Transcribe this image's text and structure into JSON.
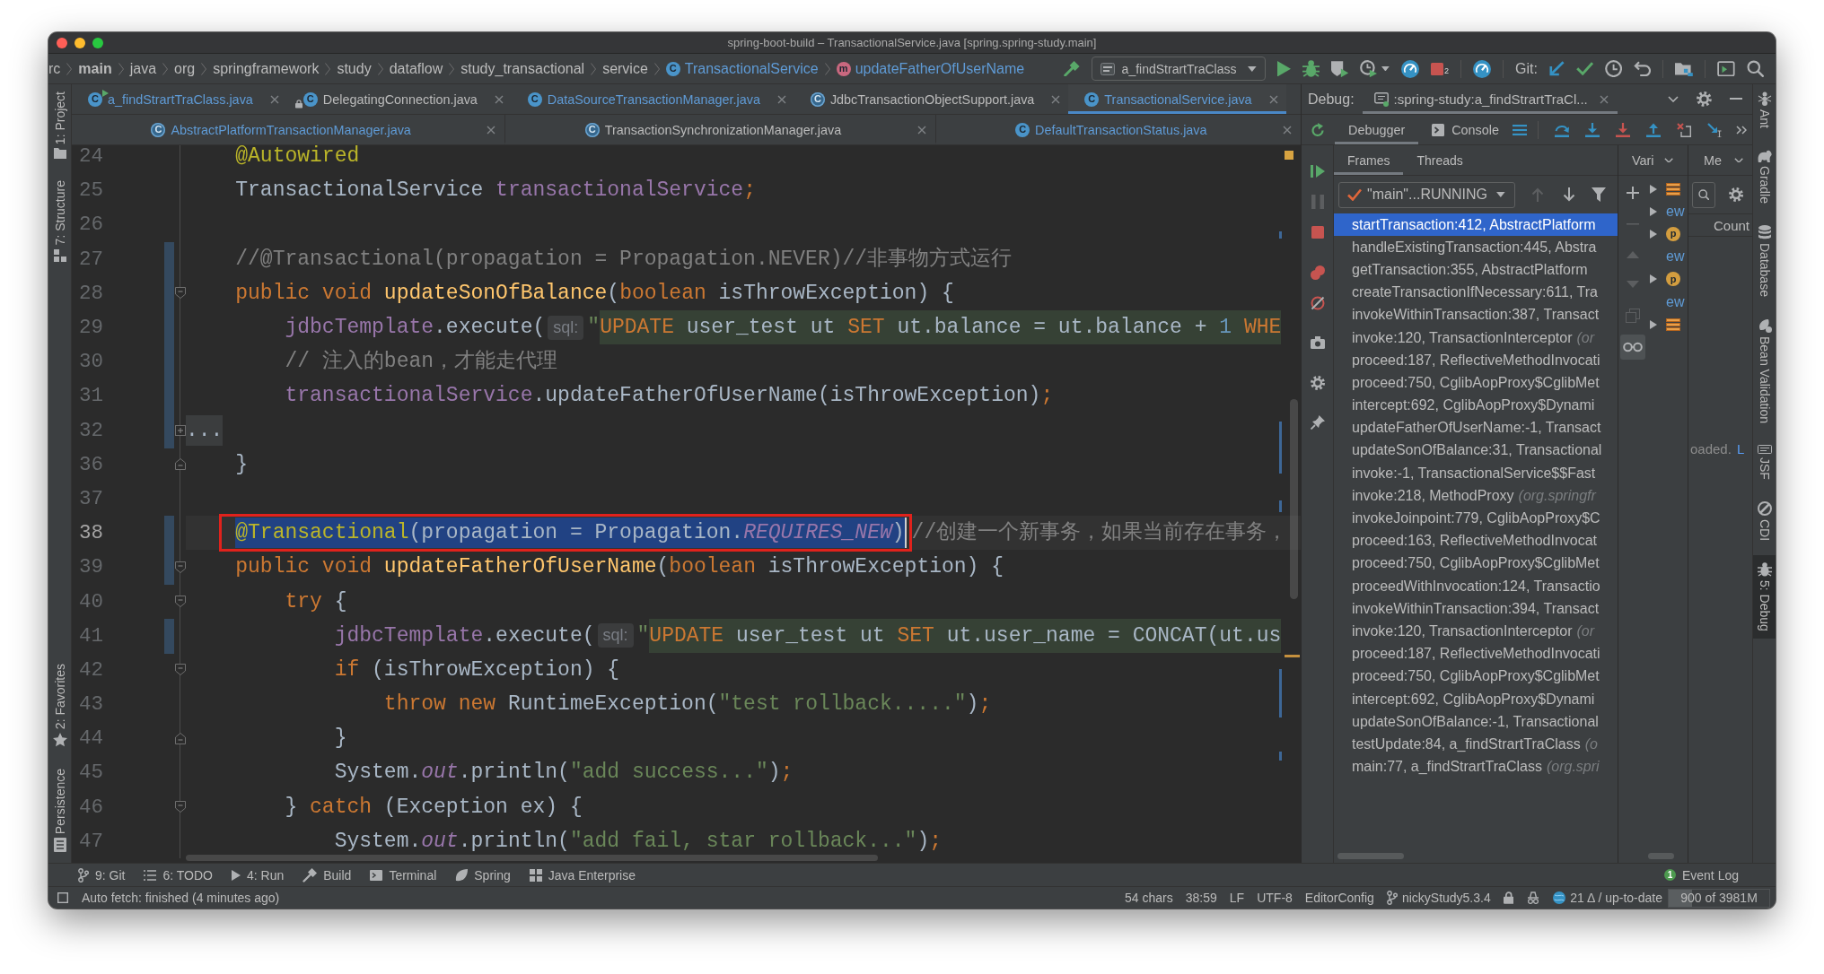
{
  "window": {
    "title": "spring-boot-build – TransactionalService.java [spring.spring-study.main]"
  },
  "navigation": {
    "breadcrumb": [
      {
        "label": "rc",
        "kind": "folder"
      },
      {
        "label": "main",
        "kind": "source_root"
      },
      {
        "label": "java",
        "kind": "folder"
      },
      {
        "label": "org",
        "kind": "folder"
      },
      {
        "label": "springframework",
        "kind": "folder"
      },
      {
        "label": "study",
        "kind": "folder"
      },
      {
        "label": "dataflow",
        "kind": "folder"
      },
      {
        "label": "study_transactional",
        "kind": "folder"
      },
      {
        "label": "service",
        "kind": "folder"
      },
      {
        "label": "TransactionalService",
        "kind": "class",
        "icon_letter": "C"
      },
      {
        "label": "updateFatherOfUserName",
        "kind": "method",
        "icon_letter": "m"
      }
    ],
    "run_configuration": "a_findStrartTraClass",
    "stop_count": "2",
    "vcs_label": "Git:"
  },
  "left_stripe": {
    "top": [
      {
        "label": "1: Project",
        "kind": "project"
      },
      {
        "label": "7: Structure",
        "kind": "structure"
      }
    ],
    "bottom": [
      {
        "label": "2: Favorites",
        "kind": "favorites"
      },
      {
        "label": "Persistence",
        "kind": "persistence"
      }
    ]
  },
  "editor_tabs": [
    [
      {
        "label": "a_findStrartTraClass.java",
        "kind": "main_class",
        "icon_letter": "C",
        "modified": true,
        "read_only": false,
        "selected": false
      },
      {
        "label": "DelegatingConnection.java",
        "kind": "class",
        "icon_letter": "C",
        "modified": false,
        "read_only": true,
        "selected": false
      },
      {
        "label": "DataSourceTransactionManager.java",
        "kind": "class",
        "icon_letter": "C",
        "modified": true,
        "read_only": false,
        "selected": false
      },
      {
        "label": "JdbcTransactionObjectSupport.java",
        "kind": "abstract_class",
        "icon_letter": "C",
        "modified": false,
        "read_only": false,
        "selected": false
      },
      {
        "label": "TransactionalService.java",
        "kind": "class",
        "icon_letter": "C",
        "modified": true,
        "read_only": false,
        "selected": true
      }
    ],
    [
      {
        "label": "AbstractPlatformTransactionManager.java",
        "kind": "abstract_class",
        "icon_letter": "C",
        "modified": true,
        "read_only": false,
        "selected": false
      },
      {
        "label": "TransactionSynchronizationManager.java",
        "kind": "abstract_class",
        "icon_letter": "C",
        "modified": false,
        "read_only": false,
        "selected": false
      },
      {
        "label": "DefaultTransactionStatus.java",
        "kind": "class",
        "icon_letter": "C",
        "modified": true,
        "read_only": false,
        "selected": false
      }
    ]
  ],
  "editor": {
    "lines": [
      {
        "number": "24",
        "kind": "plain",
        "current": false,
        "changed": false,
        "tokens": [
          {
            "kind": "annotation",
            "text": "    @Autowired"
          }
        ]
      },
      {
        "number": "25",
        "kind": "plain",
        "current": false,
        "changed": false,
        "tokens": [
          {
            "kind": "plain",
            "text": "    TransactionalService "
          },
          {
            "kind": "field",
            "text": "transactionalService"
          },
          {
            "kind": "keyword",
            "text": ";"
          }
        ]
      },
      {
        "number": "26",
        "kind": "plain",
        "current": false,
        "changed": false
      },
      {
        "number": "27",
        "kind": "plain",
        "current": false,
        "changed": true,
        "tokens": [
          {
            "kind": "comment",
            "text": "    //@Transactional(propagation = Propagation.NEVER)//非事物方式运行"
          }
        ]
      },
      {
        "number": "28",
        "kind": "fold_start",
        "current": false,
        "changed": true,
        "tokens": [
          {
            "kind": "keyword",
            "text": "    public void "
          },
          {
            "kind": "method",
            "text": "updateSonOfBalance"
          },
          {
            "kind": "plain",
            "text": "("
          },
          {
            "kind": "keyword",
            "text": "boolean "
          },
          {
            "kind": "plain",
            "text": "isThrowException) {"
          }
        ]
      },
      {
        "number": "29",
        "kind": "plain",
        "current": false,
        "changed": true,
        "tokens": [
          {
            "kind": "field",
            "text": "        jdbcTemplate"
          },
          {
            "kind": "plain",
            "text": ".execute("
          },
          {
            "kind": "hint",
            "text": "sql:"
          },
          {
            "kind": "string",
            "text": "\""
          },
          {
            "kind": "sql_keyword",
            "text": "UPDATE"
          },
          {
            "kind": "sql",
            "text": " user_test ut "
          },
          {
            "kind": "sql_keyword",
            "text": "SET"
          },
          {
            "kind": "sql",
            "text": " ut.balance = ut.balance + "
          },
          {
            "kind": "sql_number",
            "text": "1"
          },
          {
            "kind": "sql_keyword",
            "text": " WHE"
          }
        ]
      },
      {
        "number": "30",
        "kind": "plain",
        "current": false,
        "changed": true,
        "tokens": [
          {
            "kind": "comment",
            "text": "        // 注入的bean，才能走代理"
          }
        ]
      },
      {
        "number": "31",
        "kind": "plain",
        "current": false,
        "changed": true,
        "tokens": [
          {
            "kind": "field",
            "text": "        transactionalService"
          },
          {
            "kind": "plain",
            "text": ".updateFatherOfUserName(isThrowException)"
          },
          {
            "kind": "keyword",
            "text": ";"
          }
        ]
      },
      {
        "number": "32",
        "kind": "folded",
        "current": false,
        "changed": true,
        "tokens": [
          {
            "kind": "fold",
            "text": "..."
          }
        ]
      },
      {
        "number": "36",
        "kind": "fold_end",
        "current": false,
        "changed": false,
        "tokens": [
          {
            "kind": "plain",
            "text": "    }"
          }
        ]
      },
      {
        "number": "37",
        "kind": "plain",
        "current": false,
        "changed": false
      },
      {
        "number": "38",
        "kind": "plain",
        "current": true,
        "changed": true,
        "tokens": [
          {
            "kind": "selection",
            "boxed": true,
            "tokens": [
              {
                "kind": "annotation",
                "text": "    @Transactional"
              },
              {
                "kind": "plain",
                "text": "(propagation = Propagation."
              },
              {
                "kind": "static",
                "text": "REQUIRES_NEW"
              },
              {
                "kind": "plain",
                "text": ")"
              }
            ]
          },
          {
            "kind": "comment",
            "text": "//创建一个新事务，如果当前存在事务，"
          }
        ]
      },
      {
        "number": "39",
        "kind": "fold_start",
        "current": false,
        "changed": true,
        "tokens": [
          {
            "kind": "keyword",
            "text": "    public void "
          },
          {
            "kind": "method",
            "text": "updateFatherOfUserName"
          },
          {
            "kind": "plain",
            "text": "("
          },
          {
            "kind": "keyword",
            "text": "boolean "
          },
          {
            "kind": "plain",
            "text": "isThrowException) {"
          }
        ]
      },
      {
        "number": "40",
        "kind": "fold_start",
        "current": false,
        "changed": false,
        "tokens": [
          {
            "kind": "keyword",
            "text": "        try "
          },
          {
            "kind": "plain",
            "text": "{"
          }
        ]
      },
      {
        "number": "41",
        "kind": "plain",
        "current": false,
        "changed": true,
        "tokens": [
          {
            "kind": "field",
            "text": "            jdbcTemplate"
          },
          {
            "kind": "plain",
            "text": ".execute("
          },
          {
            "kind": "hint",
            "text": "sql:"
          },
          {
            "kind": "string",
            "text": "\""
          },
          {
            "kind": "sql_keyword",
            "text": "UPDATE"
          },
          {
            "kind": "sql",
            "text": " user_test ut "
          },
          {
            "kind": "sql_keyword",
            "text": "SET"
          },
          {
            "kind": "sql",
            "text": " ut.user_name = CONCAT(ut.us"
          }
        ]
      },
      {
        "number": "42",
        "kind": "fold_start",
        "current": false,
        "changed": false,
        "tokens": [
          {
            "kind": "keyword",
            "text": "            if "
          },
          {
            "kind": "plain",
            "text": "(isThrowException) {"
          }
        ]
      },
      {
        "number": "43",
        "kind": "plain",
        "current": false,
        "changed": false,
        "tokens": [
          {
            "kind": "keyword",
            "text": "                throw new "
          },
          {
            "kind": "plain",
            "text": "RuntimeException("
          },
          {
            "kind": "string",
            "text": "\"test rollback.....\""
          },
          {
            "kind": "plain",
            "text": ")"
          },
          {
            "kind": "keyword",
            "text": ";"
          }
        ]
      },
      {
        "number": "44",
        "kind": "fold_end",
        "current": false,
        "changed": false,
        "tokens": [
          {
            "kind": "plain",
            "text": "            }"
          }
        ]
      },
      {
        "number": "45",
        "kind": "plain",
        "current": false,
        "changed": false,
        "tokens": [
          {
            "kind": "plain",
            "text": "            System."
          },
          {
            "kind": "static",
            "text": "out"
          },
          {
            "kind": "plain",
            "text": ".println("
          },
          {
            "kind": "string",
            "text": "\"add success...\""
          },
          {
            "kind": "plain",
            "text": ")"
          },
          {
            "kind": "keyword",
            "text": ";"
          }
        ]
      },
      {
        "number": "46",
        "kind": "fold_start",
        "current": false,
        "changed": false,
        "tokens": [
          {
            "kind": "plain",
            "text": "        } "
          },
          {
            "kind": "keyword",
            "text": "catch "
          },
          {
            "kind": "plain",
            "text": "(Exception ex) {"
          }
        ]
      },
      {
        "number": "47",
        "kind": "plain",
        "current": false,
        "changed": false,
        "tokens": [
          {
            "kind": "plain",
            "text": "            System."
          },
          {
            "kind": "static",
            "text": "out"
          },
          {
            "kind": "plain",
            "text": ".println("
          },
          {
            "kind": "string",
            "text": "\"add fail, star rollback...\""
          },
          {
            "kind": "plain",
            "text": ")"
          },
          {
            "kind": "keyword",
            "text": ";"
          }
        ]
      }
    ]
  },
  "debug": {
    "label": "Debug:",
    "session": ":spring-study:a_findStrartTraCl...",
    "views": [
      {
        "label": "Debugger",
        "kind": "debugger",
        "selected": true
      },
      {
        "label": "Console",
        "kind": "console",
        "selected": false
      }
    ],
    "frame_tabs": [
      {
        "label": "Frames",
        "selected": true
      },
      {
        "label": "Threads",
        "selected": false
      }
    ],
    "thread": "\"main\"...RUNNING",
    "frames": [
      {
        "method": "startTransaction:412, AbstractPlatform",
        "selected": true
      },
      {
        "method": "handleExistingTransaction:445, Abstra",
        "selected": false
      },
      {
        "method": "getTransaction:355, AbstractPlatform",
        "selected": false
      },
      {
        "method": "createTransactionIfNecessary:611, Tra",
        "selected": false
      },
      {
        "method": "invokeWithinTransaction:387, Transact",
        "selected": false
      },
      {
        "method": "invoke:120, TransactionInterceptor",
        "package": "(or",
        "selected": false
      },
      {
        "method": "proceed:187, ReflectiveMethodInvocati",
        "selected": false
      },
      {
        "method": "proceed:750, CglibAopProxy$CglibMet",
        "selected": false
      },
      {
        "method": "intercept:692, CglibAopProxy$Dynami",
        "selected": false
      },
      {
        "method": "updateFatherOfUserName:-1, Transact",
        "selected": false
      },
      {
        "method": "updateSonOfBalance:31, Transactional",
        "selected": false
      },
      {
        "method": "invoke:-1, TransactionalService$$Fast",
        "selected": false
      },
      {
        "method": "invoke:218, MethodProxy",
        "package": "(org.springfr",
        "selected": false
      },
      {
        "method": "invokeJoinpoint:779, CglibAopProxy$C",
        "selected": false
      },
      {
        "method": "proceed:163, ReflectiveMethodInvocat",
        "selected": false
      },
      {
        "method": "proceed:750, CglibAopProxy$CglibMet",
        "selected": false
      },
      {
        "method": "proceedWithInvocation:124, Transactio",
        "selected": false
      },
      {
        "method": "invokeWithinTransaction:394, Transact",
        "selected": false
      },
      {
        "method": "invoke:120, TransactionInterceptor",
        "package": "(or",
        "selected": false
      },
      {
        "method": "proceed:187, ReflectiveMethodInvocati",
        "selected": false
      },
      {
        "method": "proceed:750, CglibAopProxy$CglibMet",
        "selected": false
      },
      {
        "method": "intercept:692, CglibAopProxy$Dynami",
        "selected": false
      },
      {
        "method": "updateSonOfBalance:-1, Transactional",
        "selected": false
      },
      {
        "method": "testUpdate:84, a_findStrartTraClass",
        "package": "(o",
        "selected": false
      },
      {
        "method": "main:77, a_findStrartTraClass",
        "package": "(org.spri",
        "selected": false
      }
    ],
    "variables": {
      "header": "Vari",
      "rows": [
        {
          "kind": "stack",
          "expandable": true
        },
        {
          "kind": "text",
          "text": "ew",
          "expandable": true
        },
        {
          "kind": "field",
          "icon_letter": "p",
          "expandable": true
        },
        {
          "kind": "text",
          "text": "ew",
          "expandable": false
        },
        {
          "kind": "field",
          "icon_letter": "p",
          "expandable": true
        },
        {
          "kind": "text",
          "text": "ew",
          "expandable": false
        },
        {
          "kind": "stack",
          "expandable": true
        }
      ]
    },
    "memory": {
      "header": "Me",
      "columns": [
        "Count"
      ],
      "message": "oaded.",
      "link": "L"
    }
  },
  "right_stripe": [
    {
      "label": "Ant",
      "kind": "ant",
      "selected": false
    },
    {
      "label": "Gradle",
      "kind": "gradle",
      "selected": false
    },
    {
      "label": "Database",
      "kind": "database",
      "selected": false
    },
    {
      "label": "Bean Validation",
      "kind": "bean_validation",
      "selected": false
    },
    {
      "label": "JSF",
      "kind": "jsf",
      "selected": false
    },
    {
      "label": "CDI",
      "kind": "cdi",
      "selected": false
    },
    {
      "label": "5: Debug",
      "kind": "debug",
      "selected": true
    }
  ],
  "tool_windows": [
    {
      "label": "9: Git",
      "kind": "git"
    },
    {
      "label": "6: TODO",
      "kind": "todo"
    },
    {
      "label": "4: Run",
      "kind": "run"
    },
    {
      "label": "Build",
      "kind": "build"
    },
    {
      "label": "Terminal",
      "kind": "terminal"
    },
    {
      "label": "Spring",
      "kind": "spring"
    },
    {
      "label": "Java Enterprise",
      "kind": "enterprise"
    }
  ],
  "event_log": {
    "label": "Event Log",
    "count": "1"
  },
  "status_bar": {
    "message": "Auto fetch: finished (4 minutes ago)",
    "items": [
      {
        "kind": "text",
        "text": "54 chars"
      },
      {
        "kind": "text",
        "text": "38:59"
      },
      {
        "kind": "text",
        "text": "LF"
      },
      {
        "kind": "text",
        "text": "UTF-8"
      },
      {
        "kind": "text",
        "text": "EditorConfig"
      },
      {
        "kind": "branch",
        "text": "nickyStudy5.3.4"
      },
      {
        "kind": "lock"
      },
      {
        "kind": "inspector"
      },
      {
        "kind": "vcs",
        "text": "21 Δ / up-to-date"
      }
    ],
    "memory": {
      "text": "900 of 3981M",
      "level": 0.23
    }
  }
}
